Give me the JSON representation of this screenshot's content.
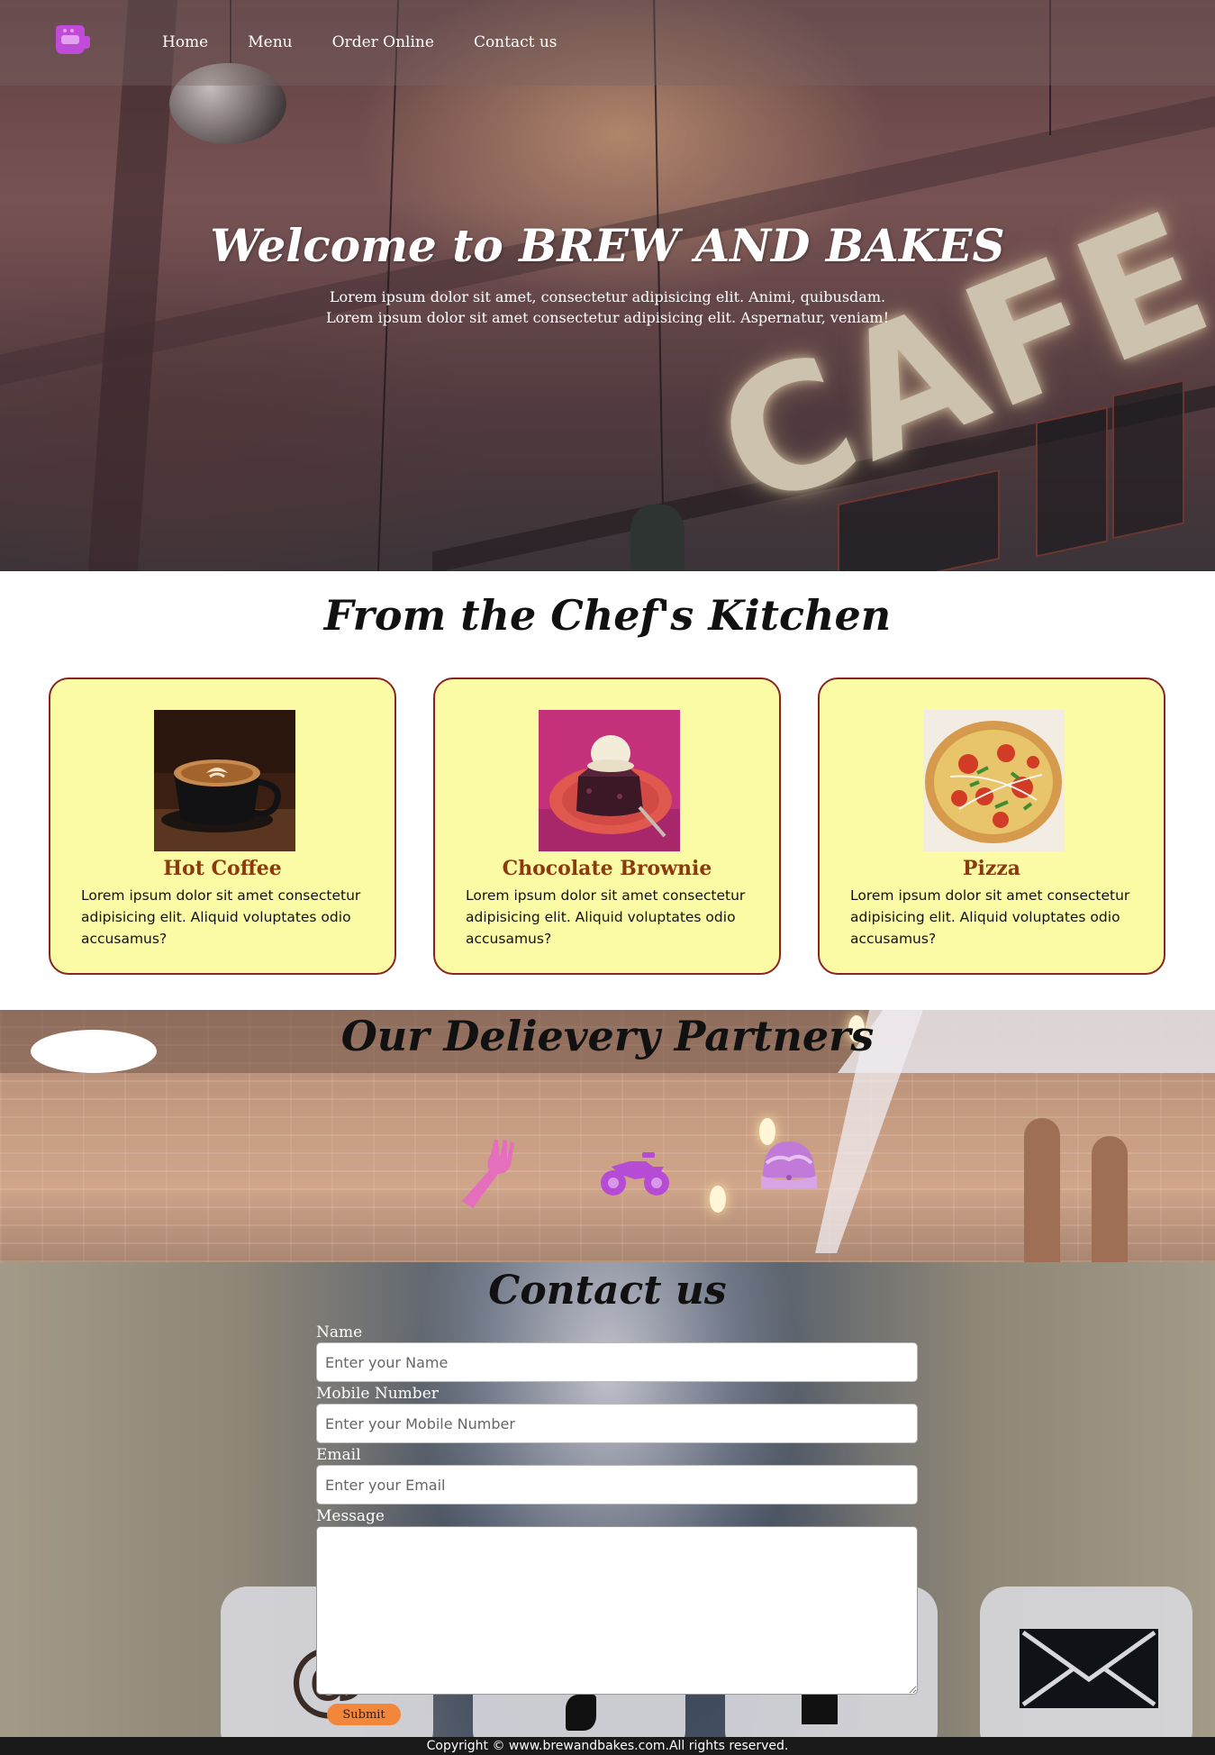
{
  "nav": {
    "logo_icon": "cafe-logo-icon",
    "links": [
      "Home",
      "Menu",
      "Order Online",
      "Contact us"
    ]
  },
  "hero": {
    "title": "Welcome to BREW AND BAKES",
    "subtitle_line1": "Lorem ipsum dolor sit amet, consectetur adipisicing elit. Animi, quibusdam.",
    "subtitle_line2": "Lorem ipsum dolor sit amet consectetur adipisicing elit. Aspernatur, veniam!",
    "sign_text": "CAFE"
  },
  "kitchen": {
    "title": "From the Chef's Kitchen",
    "items": [
      {
        "name": "Hot Coffee",
        "description": "Lorem ipsum dolor sit amet consectetur adipisicing elit. Aliquid voluptates odio accusamus?"
      },
      {
        "name": "Chocolate Brownie",
        "description": "Lorem ipsum dolor sit amet consectetur adipisicing elit. Aliquid voluptates odio accusamus?"
      },
      {
        "name": "Pizza",
        "description": "Lorem ipsum dolor sit amet consectetur adipisicing elit. Aliquid voluptates odio accusamus?"
      }
    ]
  },
  "partners": {
    "title": "Our Delievery Partners",
    "icons": [
      "fork-icon",
      "motorbike-icon",
      "taco-icon"
    ],
    "icon_colors": [
      "#e66fbd",
      "#b64bd6",
      "#c17ad8"
    ]
  },
  "contact": {
    "title": "Contact us",
    "fields": [
      {
        "label": "Name",
        "placeholder": "Enter your Name"
      },
      {
        "label": "Mobile Number",
        "placeholder": "Enter your Mobile Number"
      },
      {
        "label": "Email",
        "placeholder": "Enter your Email"
      }
    ],
    "message_label": "Message",
    "submit_label": "Submit"
  },
  "footer": {
    "text": "Copyright © www.brewandbakes.com.All rights reserved."
  },
  "colors": {
    "card_bg": "#fbfba5",
    "card_border": "#8a2323",
    "item_name": "#8b3a0e",
    "submit_bg": "#f2863a",
    "logo": "#c04bd8"
  }
}
